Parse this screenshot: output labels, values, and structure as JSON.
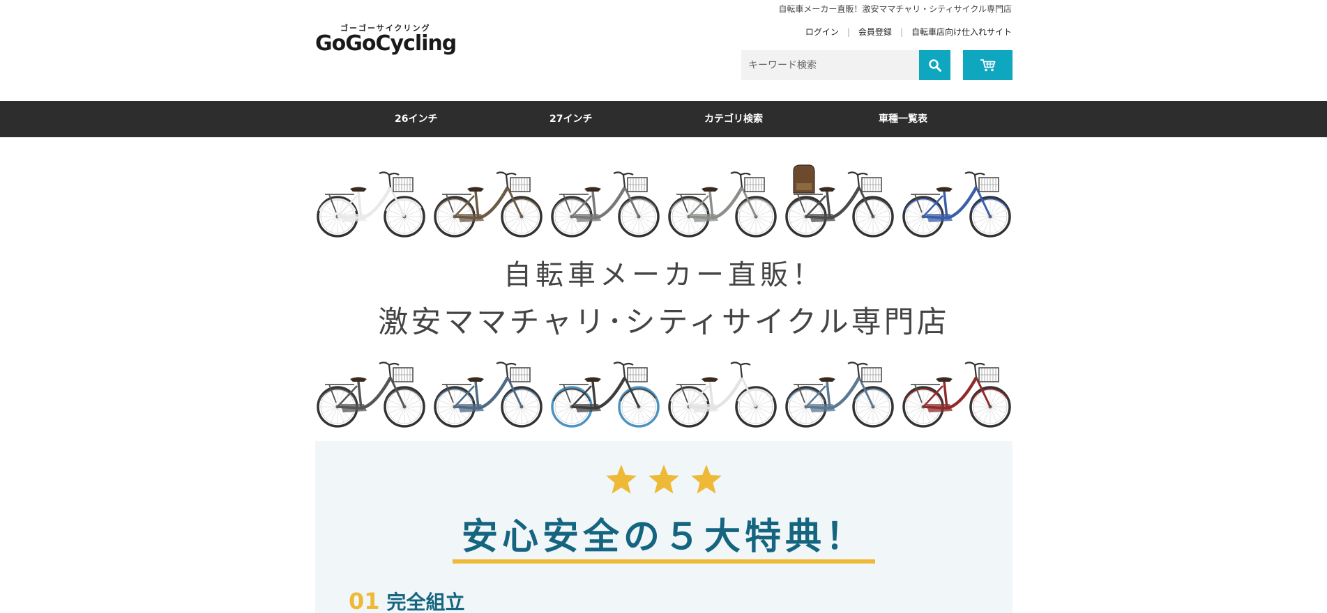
{
  "header": {
    "tagline": "自転車メーカー直販！激安ママチャリ・シティサイクル専門店",
    "logo_kana": "ゴーゴーサイクリング",
    "logo_text": "GoGoCycling",
    "links": [
      "ログイン",
      "会員登録",
      "自転車店向け仕入れサイト"
    ],
    "search": {
      "placeholder": "キーワード検索",
      "value": ""
    }
  },
  "nav": {
    "items": [
      "26インチ",
      "27インチ",
      "カテゴリ検索",
      "車種一覧表"
    ]
  },
  "hero": {
    "line1": "自転車メーカー直販！",
    "line2": "激安ママチャリ･シティサイクル専門店",
    "bikes_top": [
      {
        "frame": "#e9e9e9",
        "tire": "#333333",
        "basket": true,
        "child_seat": false
      },
      {
        "frame": "#6b5a45",
        "tire": "#333333",
        "basket": true,
        "child_seat": false
      },
      {
        "frame": "#777777",
        "tire": "#333333",
        "basket": true,
        "child_seat": false
      },
      {
        "frame": "#8c8f88",
        "tire": "#333333",
        "basket": true,
        "child_seat": false
      },
      {
        "frame": "#4b4b4b",
        "tire": "#333333",
        "basket": true,
        "child_seat": true
      },
      {
        "frame": "#3a5ea8",
        "tire": "#333333",
        "basket": true,
        "child_seat": false
      }
    ],
    "bikes_bottom": [
      {
        "frame": "#555555",
        "tire": "#333333",
        "basket": true,
        "child_seat": false
      },
      {
        "frame": "#4f6a84",
        "tire": "#333333",
        "basket": true,
        "child_seat": false
      },
      {
        "frame": "#3d3d3d",
        "tire": "#4c93c3",
        "basket": true,
        "child_seat": false
      },
      {
        "frame": "#e3e3e3",
        "tire": "#333333",
        "basket": false,
        "child_seat": false
      },
      {
        "frame": "#5c7892",
        "tire": "#333333",
        "basket": true,
        "child_seat": false
      },
      {
        "frame": "#8f2b2b",
        "tire": "#333333",
        "basket": true,
        "child_seat": false
      }
    ]
  },
  "benefits": {
    "stars": 3,
    "title": "安心安全の５大特典！",
    "point_num": "01",
    "point_title": "完全組立"
  },
  "colors": {
    "accent": "#0fa6c0",
    "nav_bg": "#2d2d2d",
    "title_blue": "#156580",
    "gold": "#eeb937",
    "benefits_bg": "#f1f6f8"
  }
}
